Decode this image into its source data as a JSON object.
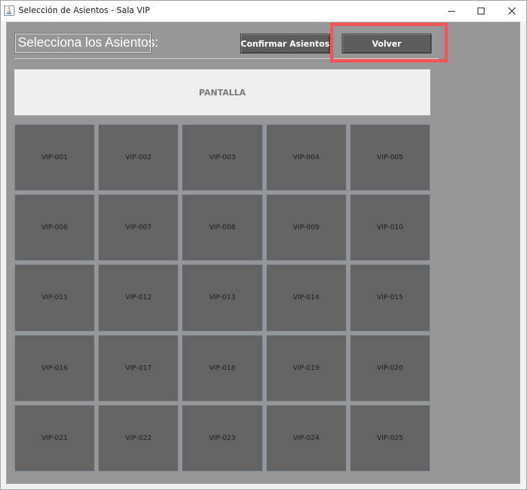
{
  "window": {
    "title": "Selección de Asientos - Sala VIP"
  },
  "header": {
    "title": "Selecciona los Asientos:",
    "confirm_label": "Confirmar Asientos",
    "back_label": "Volver"
  },
  "screen_label": "PANTALLA",
  "seats": [
    "VIP-001",
    "VIP-002",
    "VIP-003",
    "VIP-004",
    "VIP-005",
    "VIP-006",
    "VIP-007",
    "VIP-008",
    "VIP-009",
    "VIP-010",
    "VIP-011",
    "VIP-012",
    "VIP-013",
    "VIP-014",
    "VIP-015",
    "VIP-016",
    "VIP-017",
    "VIP-018",
    "VIP-019",
    "VIP-020",
    "VIP-021",
    "VIP-022",
    "VIP-023",
    "VIP-024",
    "VIP-025"
  ],
  "colors": {
    "background": "#979797",
    "seat": "#646464",
    "button": "#5c5c5c",
    "highlight": "#f25656"
  }
}
